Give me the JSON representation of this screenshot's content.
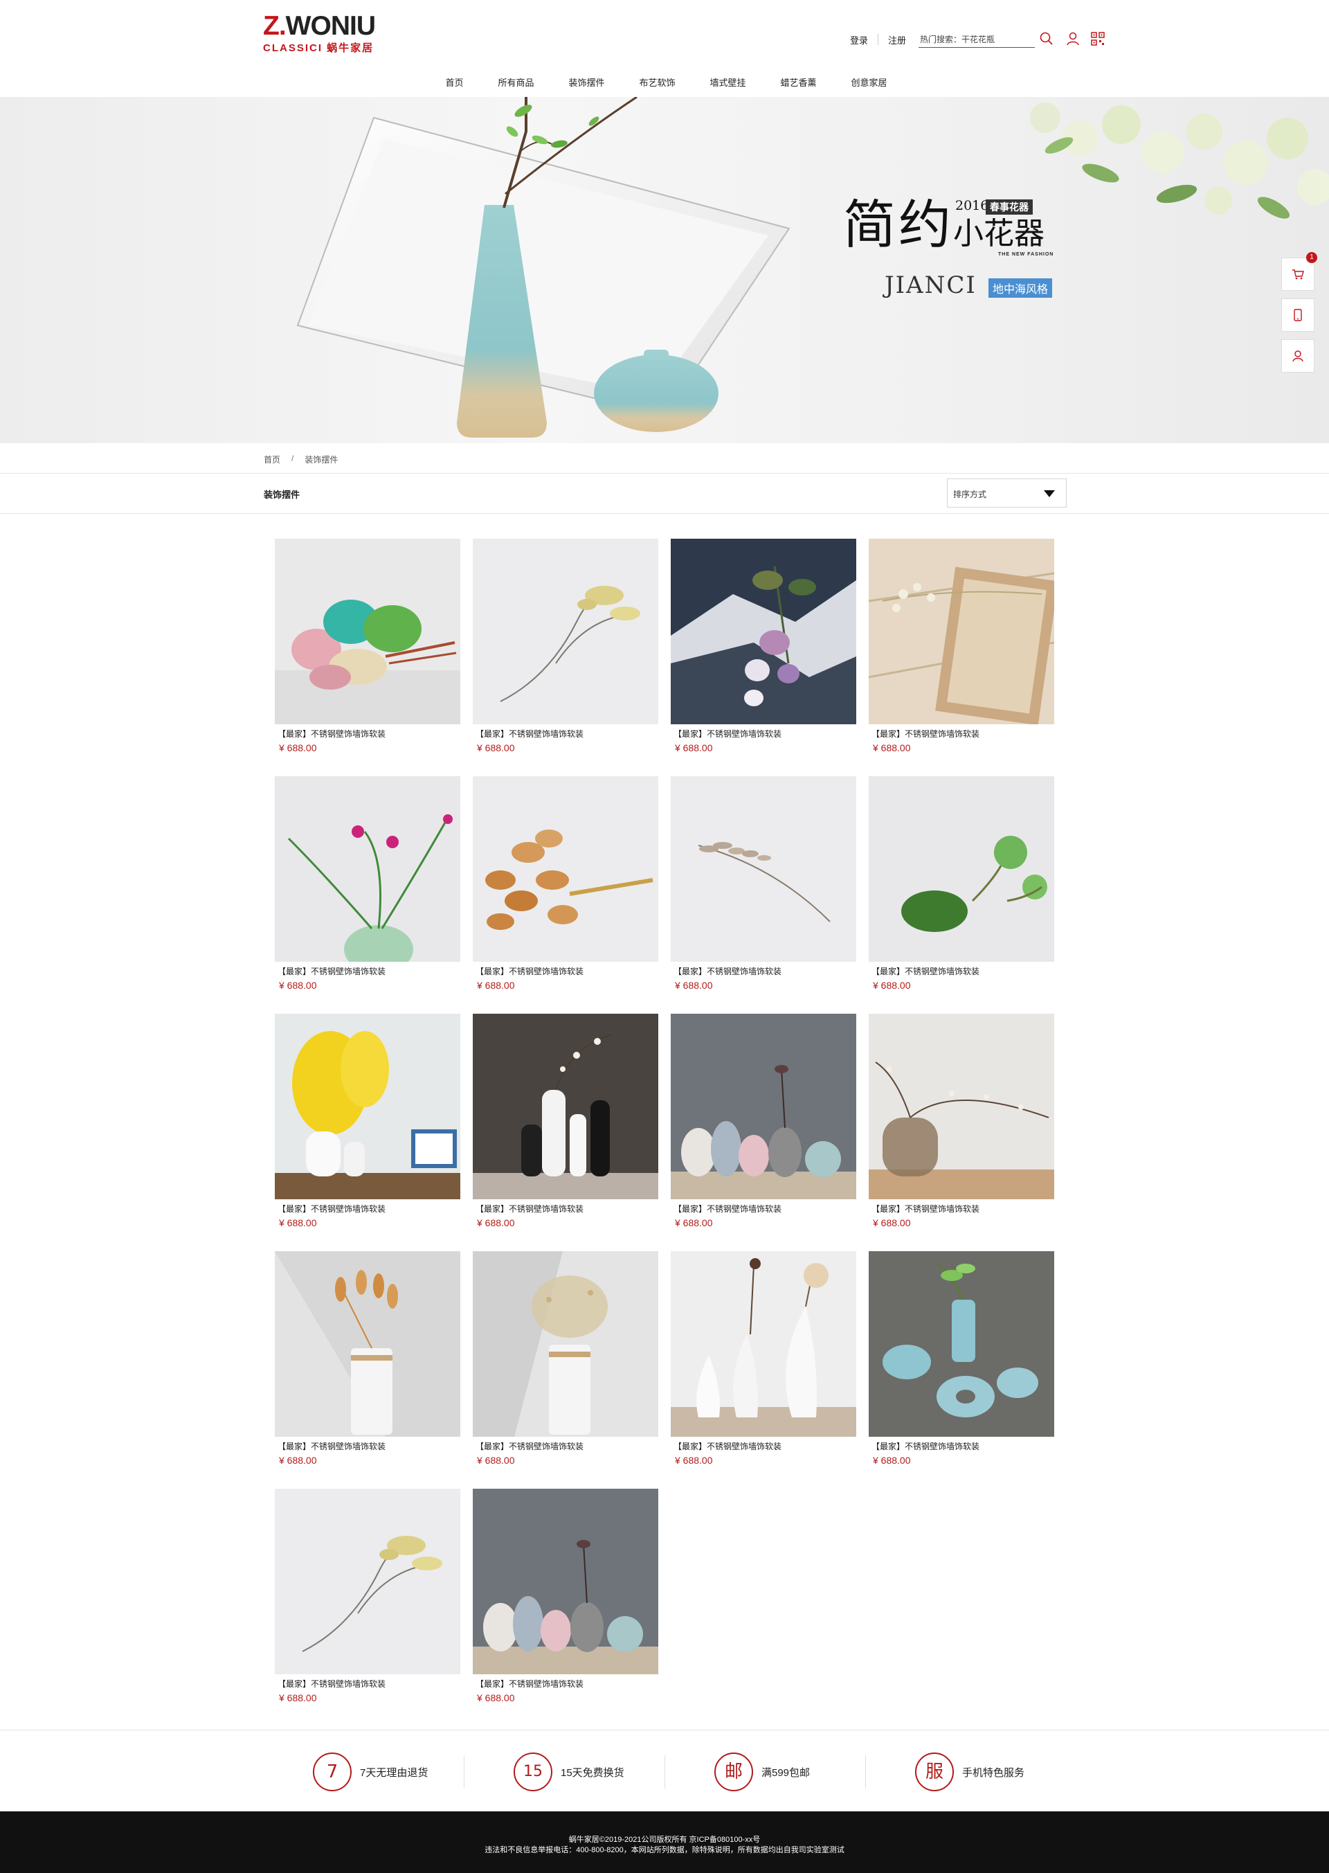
{
  "brand": {
    "logo_main": "WONIU",
    "logo_z": "Z.",
    "logo_sub": "CLASSICI 蜗牛家居"
  },
  "header": {
    "login": "登录",
    "register": "注册",
    "search_placeholder": "热门搜索：干花花瓶"
  },
  "nav": [
    "首页",
    "所有商品",
    "装饰摆件",
    "布艺软饰",
    "墙式壁挂",
    "蜡艺香薰",
    "创意家居"
  ],
  "banner": {
    "title_main": "简约",
    "title_sub": "小花器",
    "year": "2016",
    "tag": "春事花器",
    "subtitle": "THE NEW FASHION",
    "brand_word": "JIANCI",
    "style_tag": "地中海风格"
  },
  "side_tools": {
    "cart_count": "1"
  },
  "breadcrumb": {
    "home": "首页",
    "separator": "/",
    "current": "装饰摆件"
  },
  "category": {
    "title": "装饰摆件",
    "sort_label": "排序方式"
  },
  "products": [
    {
      "name": "【最家】不锈钢壁饰墙饰软装",
      "price": "¥ 688.00",
      "image": "colorful-dried-flowers"
    },
    {
      "name": "【最家】不锈钢壁饰墙饰软装",
      "price": "¥ 688.00",
      "image": "dried-yellow-sprig"
    },
    {
      "name": "【最家】不锈钢壁饰墙饰软装",
      "price": "¥ 688.00",
      "image": "flowers-in-shadow"
    },
    {
      "name": "【最家】不锈钢壁饰墙饰软装",
      "price": "¥ 688.00",
      "image": "flowers-on-wood-tray"
    },
    {
      "name": "【最家】不锈钢壁饰墙饰软装",
      "price": "¥ 688.00",
      "image": "pink-flowers-green-vase"
    },
    {
      "name": "【最家】不锈钢壁饰墙饰软装",
      "price": "¥ 688.00",
      "image": "bunny-tail-grass"
    },
    {
      "name": "【最家】不锈钢壁饰墙饰软装",
      "price": "¥ 688.00",
      "image": "dried-branch"
    },
    {
      "name": "【最家】不锈钢壁饰墙饰软装",
      "price": "¥ 688.00",
      "image": "lotus-leaves"
    },
    {
      "name": "【最家】不锈钢壁饰墙饰软装",
      "price": "¥ 688.00",
      "image": "yellow-orchid-vases"
    },
    {
      "name": "【最家】不锈钢壁饰墙饰软装",
      "price": "¥ 688.00",
      "image": "black-white-bottles"
    },
    {
      "name": "【最家】不锈钢壁饰墙饰软装",
      "price": "¥ 688.00",
      "image": "ceramic-vase-group"
    },
    {
      "name": "【最家】不锈钢壁饰墙饰软装",
      "price": "¥ 688.00",
      "image": "glass-vase-blossom"
    },
    {
      "name": "【最家】不锈钢壁饰墙饰软装",
      "price": "¥ 688.00",
      "image": "white-vase-grass"
    },
    {
      "name": "【最家】不锈钢壁饰墙饰软装",
      "price": "¥ 688.00",
      "image": "white-vase-dried"
    },
    {
      "name": "【最家】不锈钢壁饰墙饰软装",
      "price": "¥ 688.00",
      "image": "white-droplet-vases"
    },
    {
      "name": "【最家】不锈钢壁饰墙饰软装",
      "price": "¥ 688.00",
      "image": "blue-ceramics"
    },
    {
      "name": "【最家】不锈钢壁饰墙饰软装",
      "price": "¥ 688.00",
      "image": "dried-yellow-sprig"
    },
    {
      "name": "【最家】不锈钢壁饰墙饰软装",
      "price": "¥ 688.00",
      "image": "ceramic-vase-group"
    }
  ],
  "services": [
    {
      "icon": "7",
      "label": "7天无理由退货"
    },
    {
      "icon": "15",
      "label": "15天免费换货"
    },
    {
      "icon": "邮",
      "label": "满599包邮"
    },
    {
      "icon": "服",
      "label": "手机特色服务"
    }
  ],
  "footer": {
    "line1": "蜗牛家居©2019-2021公司版权所有 京ICP备080100-xx号",
    "line2": "违法和不良信息举报电话：400-800-8200，本网站所列数据，除特殊说明，所有数据均出自我司实验室测试"
  },
  "colors": {
    "accent": "#c4161c",
    "price": "#b31b1b",
    "footer_bg": "#111111",
    "style_tag_bg": "#4a8fd1"
  }
}
